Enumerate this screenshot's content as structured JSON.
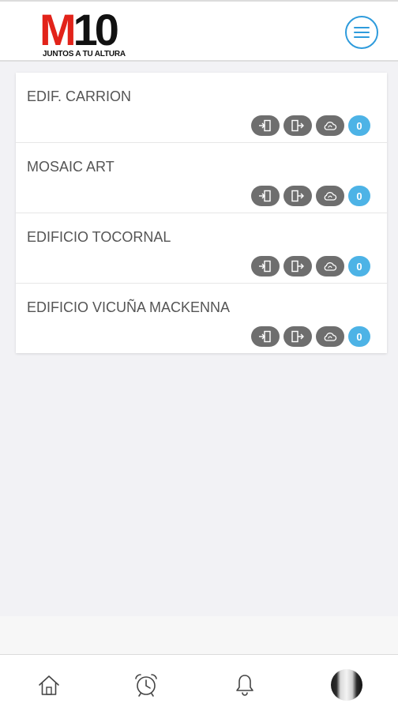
{
  "app": {
    "logo_text": "M10",
    "logo_tagline": "JUNTOS A TU ALTURA"
  },
  "header": {
    "menu_icon": "hamburger-menu-icon"
  },
  "buildings": [
    {
      "name": "EDIF. CARRION",
      "count": "0"
    },
    {
      "name": "MOSAIC ART",
      "count": "0"
    },
    {
      "name": "EDIFICIO TOCORNAL",
      "count": "0"
    },
    {
      "name": "EDIFICIO VICUÑA MACKENNA",
      "count": "0"
    }
  ],
  "item_actions": [
    "door-enter-icon",
    "door-exit-icon",
    "cloud-sync-icon"
  ],
  "bottom_nav": [
    "home-icon",
    "alarm-clock-icon",
    "bell-icon",
    "avatar"
  ],
  "colors": {
    "brand_red": "#e2231a",
    "accent_blue": "#2e9bdc",
    "badge_blue": "#4db3e6",
    "pill_gray": "#6e6e6e"
  }
}
